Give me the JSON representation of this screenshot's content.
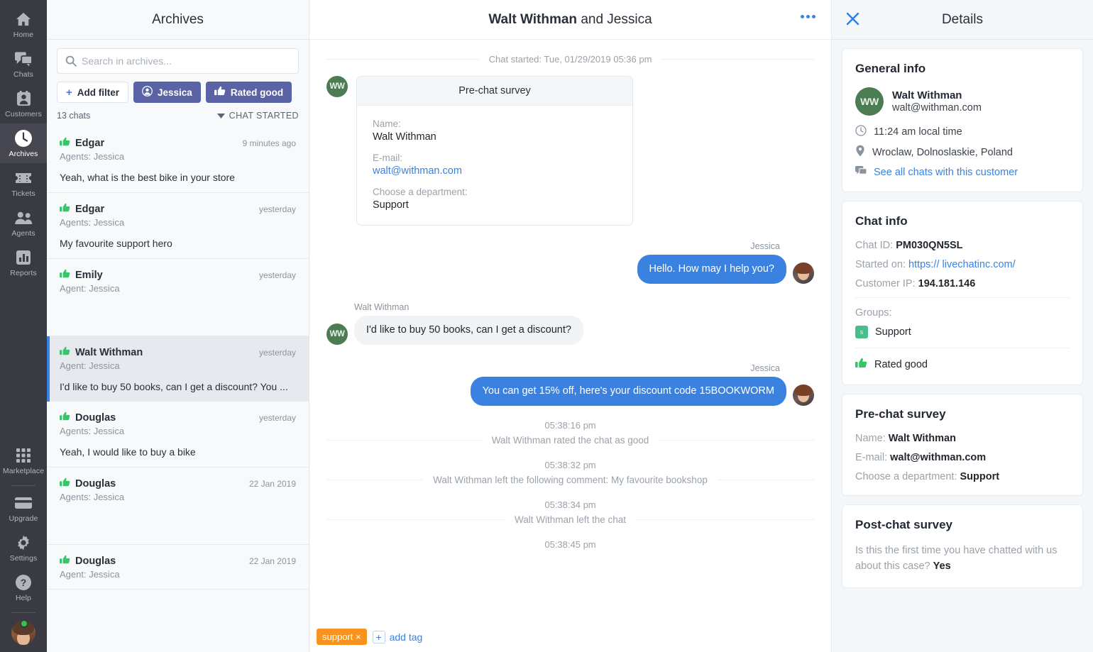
{
  "rail": {
    "items": [
      {
        "label": "Home",
        "icon": "home-icon",
        "active": false
      },
      {
        "label": "Chats",
        "icon": "chats-icon",
        "active": false
      },
      {
        "label": "Customers",
        "icon": "customers-icon",
        "active": false
      },
      {
        "label": "Archives",
        "icon": "clock-icon",
        "active": true
      },
      {
        "label": "Tickets",
        "icon": "ticket-icon",
        "active": false
      },
      {
        "label": "Agents",
        "icon": "agents-icon",
        "active": false
      },
      {
        "label": "Reports",
        "icon": "reports-icon",
        "active": false
      }
    ],
    "bottom": [
      {
        "label": "Marketplace",
        "icon": "grid-icon"
      },
      {
        "label": "Upgrade",
        "icon": "card-icon"
      },
      {
        "label": "Settings",
        "icon": "gear-icon"
      },
      {
        "label": "Help",
        "icon": "help-icon"
      }
    ]
  },
  "archives": {
    "title": "Archives",
    "search_placeholder": "Search in archives...",
    "search_value": "",
    "filters": {
      "add_label": "Add filter",
      "chips": [
        {
          "label": "Jessica",
          "icon": "person-icon"
        },
        {
          "label": "Rated good",
          "icon": "thumbs-up-icon"
        }
      ]
    },
    "count_label": "13 chats",
    "sort_label": "CHAT STARTED",
    "items": [
      {
        "name": "Edgar",
        "agent": "Agents: Jessica",
        "time": "9 minutes ago",
        "message": "Yeah, what is the best bike in your store",
        "active": false
      },
      {
        "name": "Edgar",
        "agent": "Agents: Jessica",
        "time": "yesterday",
        "message": "My favourite support hero",
        "active": false
      },
      {
        "name": "Emily",
        "agent": "Agent: Jessica",
        "time": "yesterday",
        "message": "",
        "active": false
      },
      {
        "name": "Walt Withman",
        "agent": "Agent: Jessica",
        "time": "yesterday",
        "message": "I'd like to buy 50 books, can I get a discount? You ...",
        "active": true
      },
      {
        "name": "Douglas",
        "agent": "Agents: Jessica",
        "time": "yesterday",
        "message": "Yeah, I would like to buy a bike",
        "active": false
      },
      {
        "name": "Douglas",
        "agent": "Agents: Jessica",
        "time": "22 Jan 2019",
        "message": "",
        "active": false
      },
      {
        "name": "Douglas",
        "agent": "Agent: Jessica",
        "time": "22 Jan 2019",
        "message": "",
        "active": false
      }
    ]
  },
  "chat": {
    "title_bold": "Walt Withman",
    "title_rest": " and Jessica",
    "started_divider": "Chat started: Tue, 01/29/2019 05:36 pm",
    "customer_initials": "WW",
    "survey": {
      "header": "Pre-chat survey",
      "fields": [
        {
          "label": "Name:",
          "value": "Walt Withman",
          "is_link": false
        },
        {
          "label": "E-mail:",
          "value": "walt@withman.com",
          "is_link": true
        },
        {
          "label": "Choose a department:",
          "value": "Support",
          "is_link": false
        }
      ]
    },
    "messages": [
      {
        "sender": "Jessica",
        "text": "Hello. How may I help you?",
        "direction": "out"
      },
      {
        "sender": "Walt Withman",
        "text": "I'd like to buy 50 books, can I get a discount?",
        "direction": "in"
      },
      {
        "sender": "Jessica",
        "text": "You can get 15% off, here's your discount code 15BOOKWORM",
        "direction": "out"
      }
    ],
    "events": [
      {
        "time": "05:38:16 pm",
        "text": "Walt Withman rated the chat as good"
      },
      {
        "time": "05:38:32 pm",
        "text": "Walt Withman left the following comment: My favourite bookshop"
      },
      {
        "time": "05:38:34 pm",
        "text": "Walt Withman left the chat"
      },
      {
        "time": "05:38:45 pm",
        "text": ""
      }
    ],
    "tags": {
      "tag_label": "support",
      "tag_remove": "×",
      "add_label": "add tag",
      "add_plus": "+"
    }
  },
  "details": {
    "title": "Details",
    "general": {
      "title": "General info",
      "initials": "WW",
      "name": "Walt Withman",
      "email": "walt@withman.com",
      "local_time": "11:24 am local time",
      "location": "Wroclaw, Dolnoslaskie, Poland",
      "see_all_link": "See all chats with this customer"
    },
    "chat_info": {
      "title": "Chat info",
      "chat_id_label": "Chat ID:",
      "chat_id": "PM030QN5SL",
      "started_label": "Started on:",
      "started_url": "https:// livechatinc.com/",
      "ip_label": "Customer IP:",
      "ip": "194.181.146",
      "groups_label": "Groups:",
      "group_badge": "s",
      "group_name": "Support",
      "rating": "Rated good"
    },
    "pre_chat": {
      "title": "Pre-chat survey",
      "rows": [
        {
          "label": "Name:",
          "value": "Walt Withman"
        },
        {
          "label": "E-mail:",
          "value": "walt@withman.com"
        },
        {
          "label": "Choose a department:",
          "value": "Support"
        }
      ]
    },
    "post_chat": {
      "title": "Post-chat survey",
      "question": "Is this the first time you have chatted with us about this case?",
      "answer": "Yes"
    }
  },
  "colors": {
    "accent_blue": "#3b82e0",
    "chip_slate": "#5a63a5",
    "green_avatar": "#4c7d52",
    "thumb_green": "#35c667",
    "tag_orange": "#f7931e",
    "rail_bg": "#3a3a42"
  }
}
